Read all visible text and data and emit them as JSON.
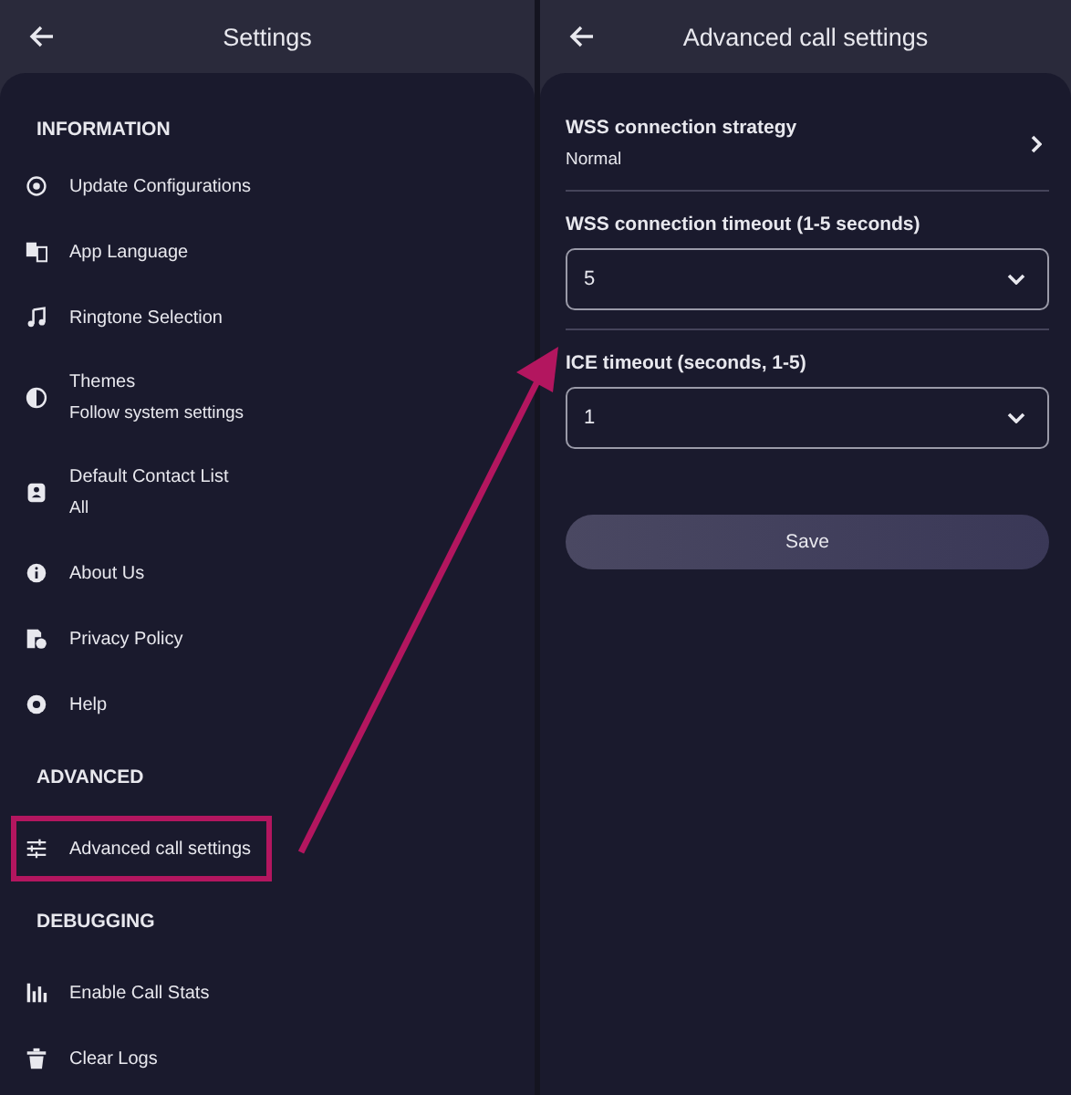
{
  "settings": {
    "title": "Settings",
    "sections": [
      {
        "heading": "INFORMATION",
        "items": [
          {
            "label": "Update Configurations",
            "highlighted": false
          },
          {
            "label": "App Language",
            "highlighted": false
          },
          {
            "label": "Ringtone Selection",
            "highlighted": false
          },
          {
            "label": "Themes",
            "value": "Follow system settings",
            "highlighted": false
          },
          {
            "label": "Default Contact List",
            "value": "All",
            "highlighted": false
          },
          {
            "label": "About Us",
            "highlighted": false
          },
          {
            "label": "Privacy Policy",
            "highlighted": false
          },
          {
            "label": "Help",
            "highlighted": false
          }
        ]
      },
      {
        "heading": "ADVANCED",
        "items": [
          {
            "label": "Advanced call settings",
            "highlighted": true
          }
        ]
      },
      {
        "heading": "DEBUGGING",
        "items": [
          {
            "label": "Enable Call Stats",
            "highlighted": false
          },
          {
            "label": "Clear Logs",
            "highlighted": false
          }
        ]
      }
    ]
  },
  "advanced": {
    "title": "Advanced call settings",
    "fields": [
      {
        "kind": "link",
        "label": "WSS connection strategy",
        "value": "Normal"
      },
      {
        "kind": "select",
        "label": "WSS connection timeout (1-5 seconds)",
        "value": "5"
      },
      {
        "kind": "select",
        "label": "ICE timeout (seconds, 1-5)",
        "value": "1"
      }
    ],
    "button": "Save"
  }
}
